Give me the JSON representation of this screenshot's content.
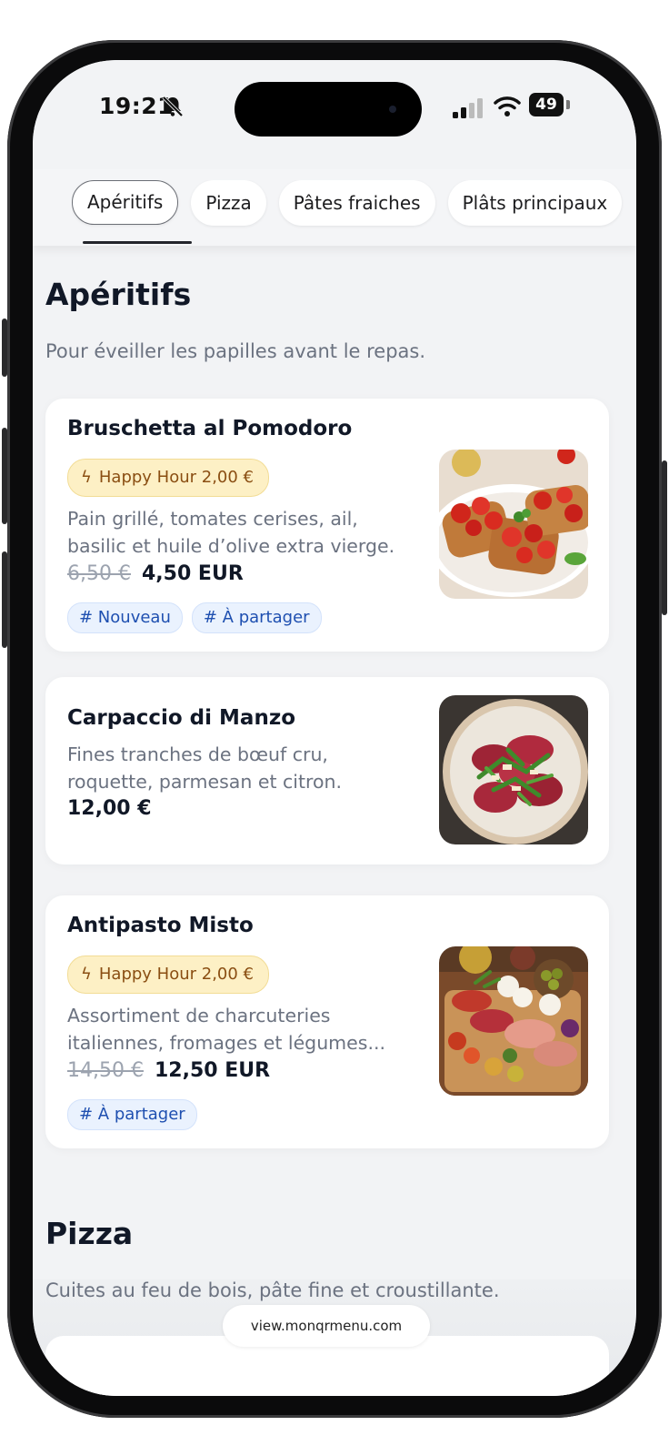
{
  "status_bar": {
    "time": "19:21",
    "battery": "49"
  },
  "tabs": [
    {
      "label": "Apéritifs",
      "active": true
    },
    {
      "label": "Pizza",
      "active": false
    },
    {
      "label": "Pâtes fraiches",
      "active": false
    },
    {
      "label": "Plâts principaux",
      "active": false
    }
  ],
  "sections": {
    "aperitifs": {
      "title": "Apéritifs",
      "subtitle": "Pour éveiller les papilles avant le repas."
    },
    "pizza": {
      "title": "Pizza",
      "subtitle": "Cuites au feu de bois, pâte fine et croustillante."
    }
  },
  "items": [
    {
      "name": "Bruschetta al Pomodoro",
      "badge": "Happy Hour 2,00 €",
      "description_lines": [
        "Pain grillé, tomates cerises, ail,",
        "basilic et huile d’olive extra vierge."
      ],
      "old_price": "6,50 €",
      "price": "4,50 EUR",
      "tags": [
        "# Nouveau",
        "# À partager"
      ]
    },
    {
      "name": "Carpaccio di Manzo",
      "description_lines": [
        "Fines tranches de bœuf cru,",
        "roquette, parmesan et citron."
      ],
      "price": "12,00 €"
    },
    {
      "name": "Antipasto Misto",
      "badge": "Happy Hour 2,00 €",
      "description_lines": [
        "Assortiment de charcuteries",
        "italiennes, fromages et légumes..."
      ],
      "old_price": "14,50 €",
      "price": "12,50 EUR",
      "tags": [
        "# À partager"
      ]
    }
  ],
  "browser": {
    "url": "view.monqrmenu.com"
  },
  "colors": {
    "badge_bg": "#fdf0c5",
    "badge_text": "#8a4e12",
    "tag_bg": "#eaf2fe",
    "tag_text": "#1e4fb0",
    "page_bg": "#f2f3f5"
  }
}
